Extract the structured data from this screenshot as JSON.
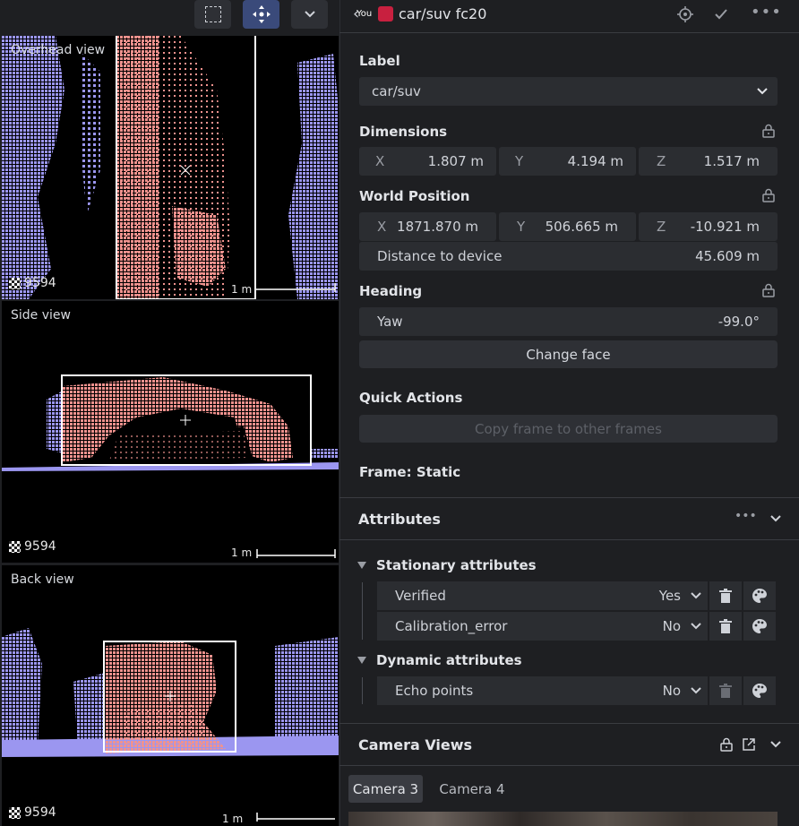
{
  "header": {
    "you_badge": "You",
    "object_title": "car/suv fc20",
    "object_color": "#c8203f"
  },
  "views": {
    "overhead": {
      "title": "Overhead view",
      "count": "9594",
      "scale": "1 m"
    },
    "side": {
      "title": "Side view",
      "count": "9594",
      "scale": "1 m"
    },
    "back": {
      "title": "Back view",
      "count": "9594",
      "scale": "1 m"
    }
  },
  "label_section": {
    "title": "Label",
    "value": "car/suv"
  },
  "dimensions": {
    "title": "Dimensions",
    "x_label": "X",
    "x_value": "1.807 m",
    "y_label": "Y",
    "y_value": "4.194 m",
    "z_label": "Z",
    "z_value": "1.517 m"
  },
  "world_position": {
    "title": "World Position",
    "x_label": "X",
    "x_value": "1871.870 m",
    "y_label": "Y",
    "y_value": "506.665 m",
    "z_label": "Z",
    "z_value": "-10.921 m",
    "distance_label": "Distance to device",
    "distance_value": "45.609 m"
  },
  "heading": {
    "title": "Heading",
    "yaw_label": "Yaw",
    "yaw_value": "-99.0°",
    "change_face": "Change face"
  },
  "quick_actions": {
    "title": "Quick Actions",
    "copy_frame": "Copy frame to other frames"
  },
  "frame_status": "Frame: Static",
  "attributes": {
    "title": "Attributes",
    "stationary_title": "Stationary attributes",
    "stationary": [
      {
        "name": "Verified",
        "value": "Yes"
      },
      {
        "name": "Calibration_error",
        "value": "No"
      }
    ],
    "dynamic_title": "Dynamic attributes",
    "dynamic": [
      {
        "name": "Echo points",
        "value": "No"
      }
    ]
  },
  "camera_views": {
    "title": "Camera Views",
    "tabs": [
      "Camera 3",
      "Camera 4"
    ]
  },
  "colors": {
    "accent_active": "#3a4a7a",
    "point_blue": "#9b96f0",
    "point_pink": "#f0928e"
  }
}
